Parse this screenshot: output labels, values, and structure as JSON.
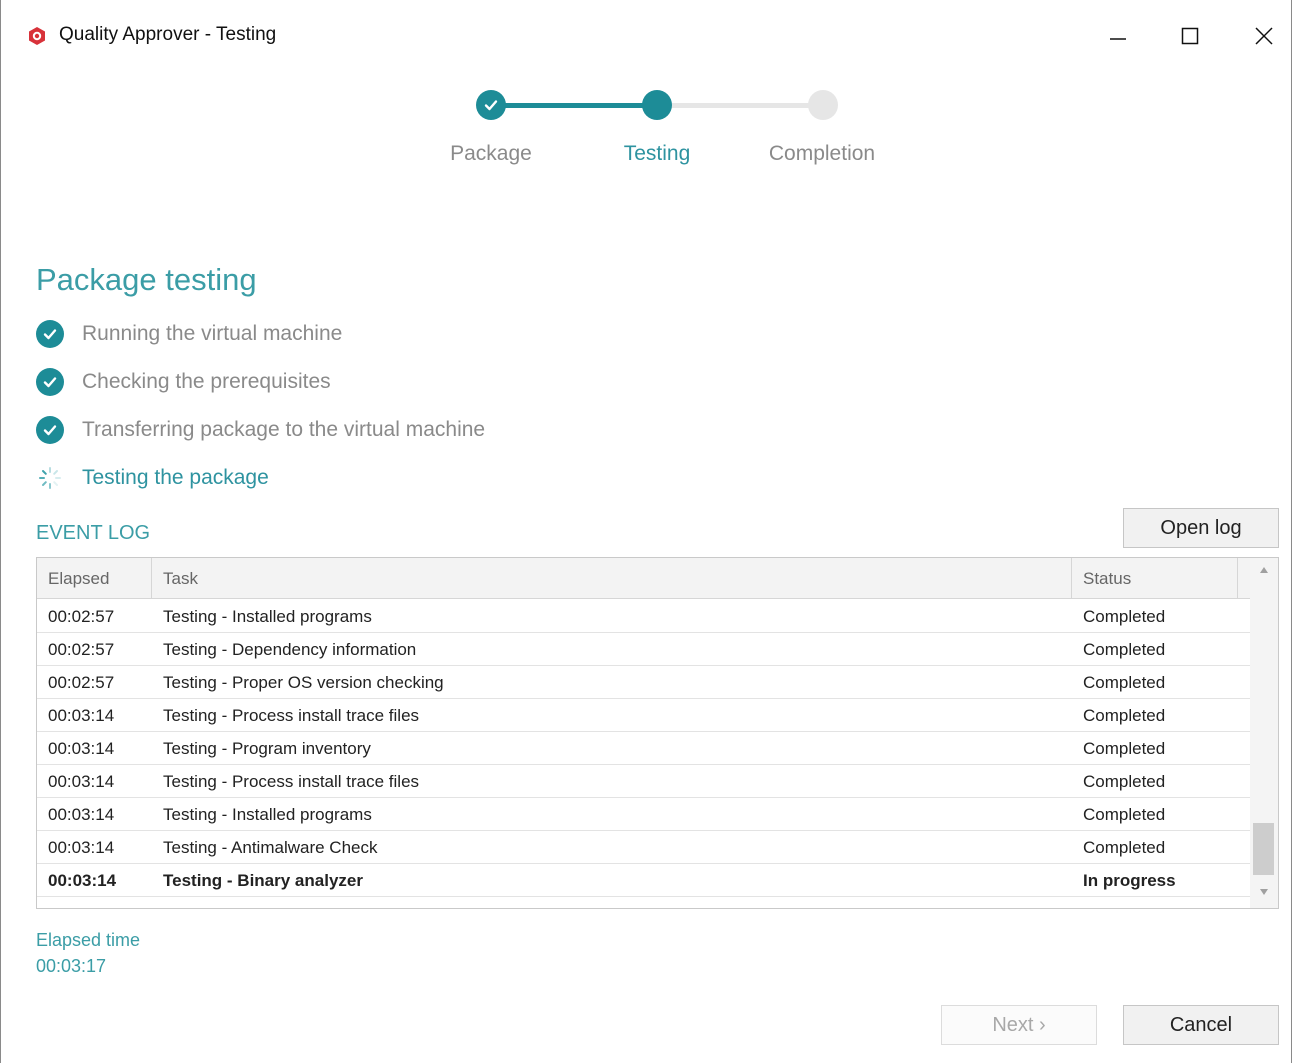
{
  "window": {
    "title": "Quality Approver - Testing",
    "icons": {
      "app": "app-logo-icon",
      "minimize": "minimize-icon",
      "maximize": "maximize-icon",
      "close": "close-icon"
    }
  },
  "stepper": {
    "steps": [
      {
        "label": "Package",
        "state": "done"
      },
      {
        "label": "Testing",
        "state": "current"
      },
      {
        "label": "Completion",
        "state": "pending"
      }
    ],
    "colors": {
      "accent": "#1d8c97",
      "pending": "#e6e6e6",
      "pending_text": "#8a8a8a"
    }
  },
  "page": {
    "title": "Package testing",
    "checklist": [
      {
        "label": "Running the virtual machine",
        "state": "done",
        "icon": "check-circle-icon"
      },
      {
        "label": "Checking the prerequisites",
        "state": "done",
        "icon": "check-circle-icon"
      },
      {
        "label": "Transferring package to the virtual machine",
        "state": "done",
        "icon": "check-circle-icon"
      },
      {
        "label": "Testing the package",
        "state": "in-progress",
        "icon": "spinner-icon"
      }
    ]
  },
  "event_log": {
    "heading": "EVENT LOG",
    "open_log_label": "Open log",
    "columns": {
      "elapsed": "Elapsed",
      "task": "Task",
      "status": "Status"
    },
    "rows": [
      {
        "elapsed": "00:02:57",
        "task": "Testing - Installed programs",
        "status": "Completed"
      },
      {
        "elapsed": "00:02:57",
        "task": "Testing - Dependency information",
        "status": "Completed"
      },
      {
        "elapsed": "00:02:57",
        "task": "Testing - Proper OS version checking",
        "status": "Completed"
      },
      {
        "elapsed": "00:03:14",
        "task": "Testing - Process install trace files",
        "status": "Completed"
      },
      {
        "elapsed": "00:03:14",
        "task": "Testing - Program inventory",
        "status": "Completed"
      },
      {
        "elapsed": "00:03:14",
        "task": "Testing - Process install trace files",
        "status": "Completed"
      },
      {
        "elapsed": "00:03:14",
        "task": "Testing - Installed programs",
        "status": "Completed"
      },
      {
        "elapsed": "00:03:14",
        "task": "Testing - Antimalware Check",
        "status": "Completed"
      },
      {
        "elapsed": "00:03:14",
        "task": "Testing - Binary analyzer",
        "status": "In progress",
        "bold": true
      }
    ]
  },
  "elapsed": {
    "label": "Elapsed time",
    "value": "00:03:17"
  },
  "footer": {
    "next_label": "Next ›",
    "cancel_label": "Cancel"
  }
}
